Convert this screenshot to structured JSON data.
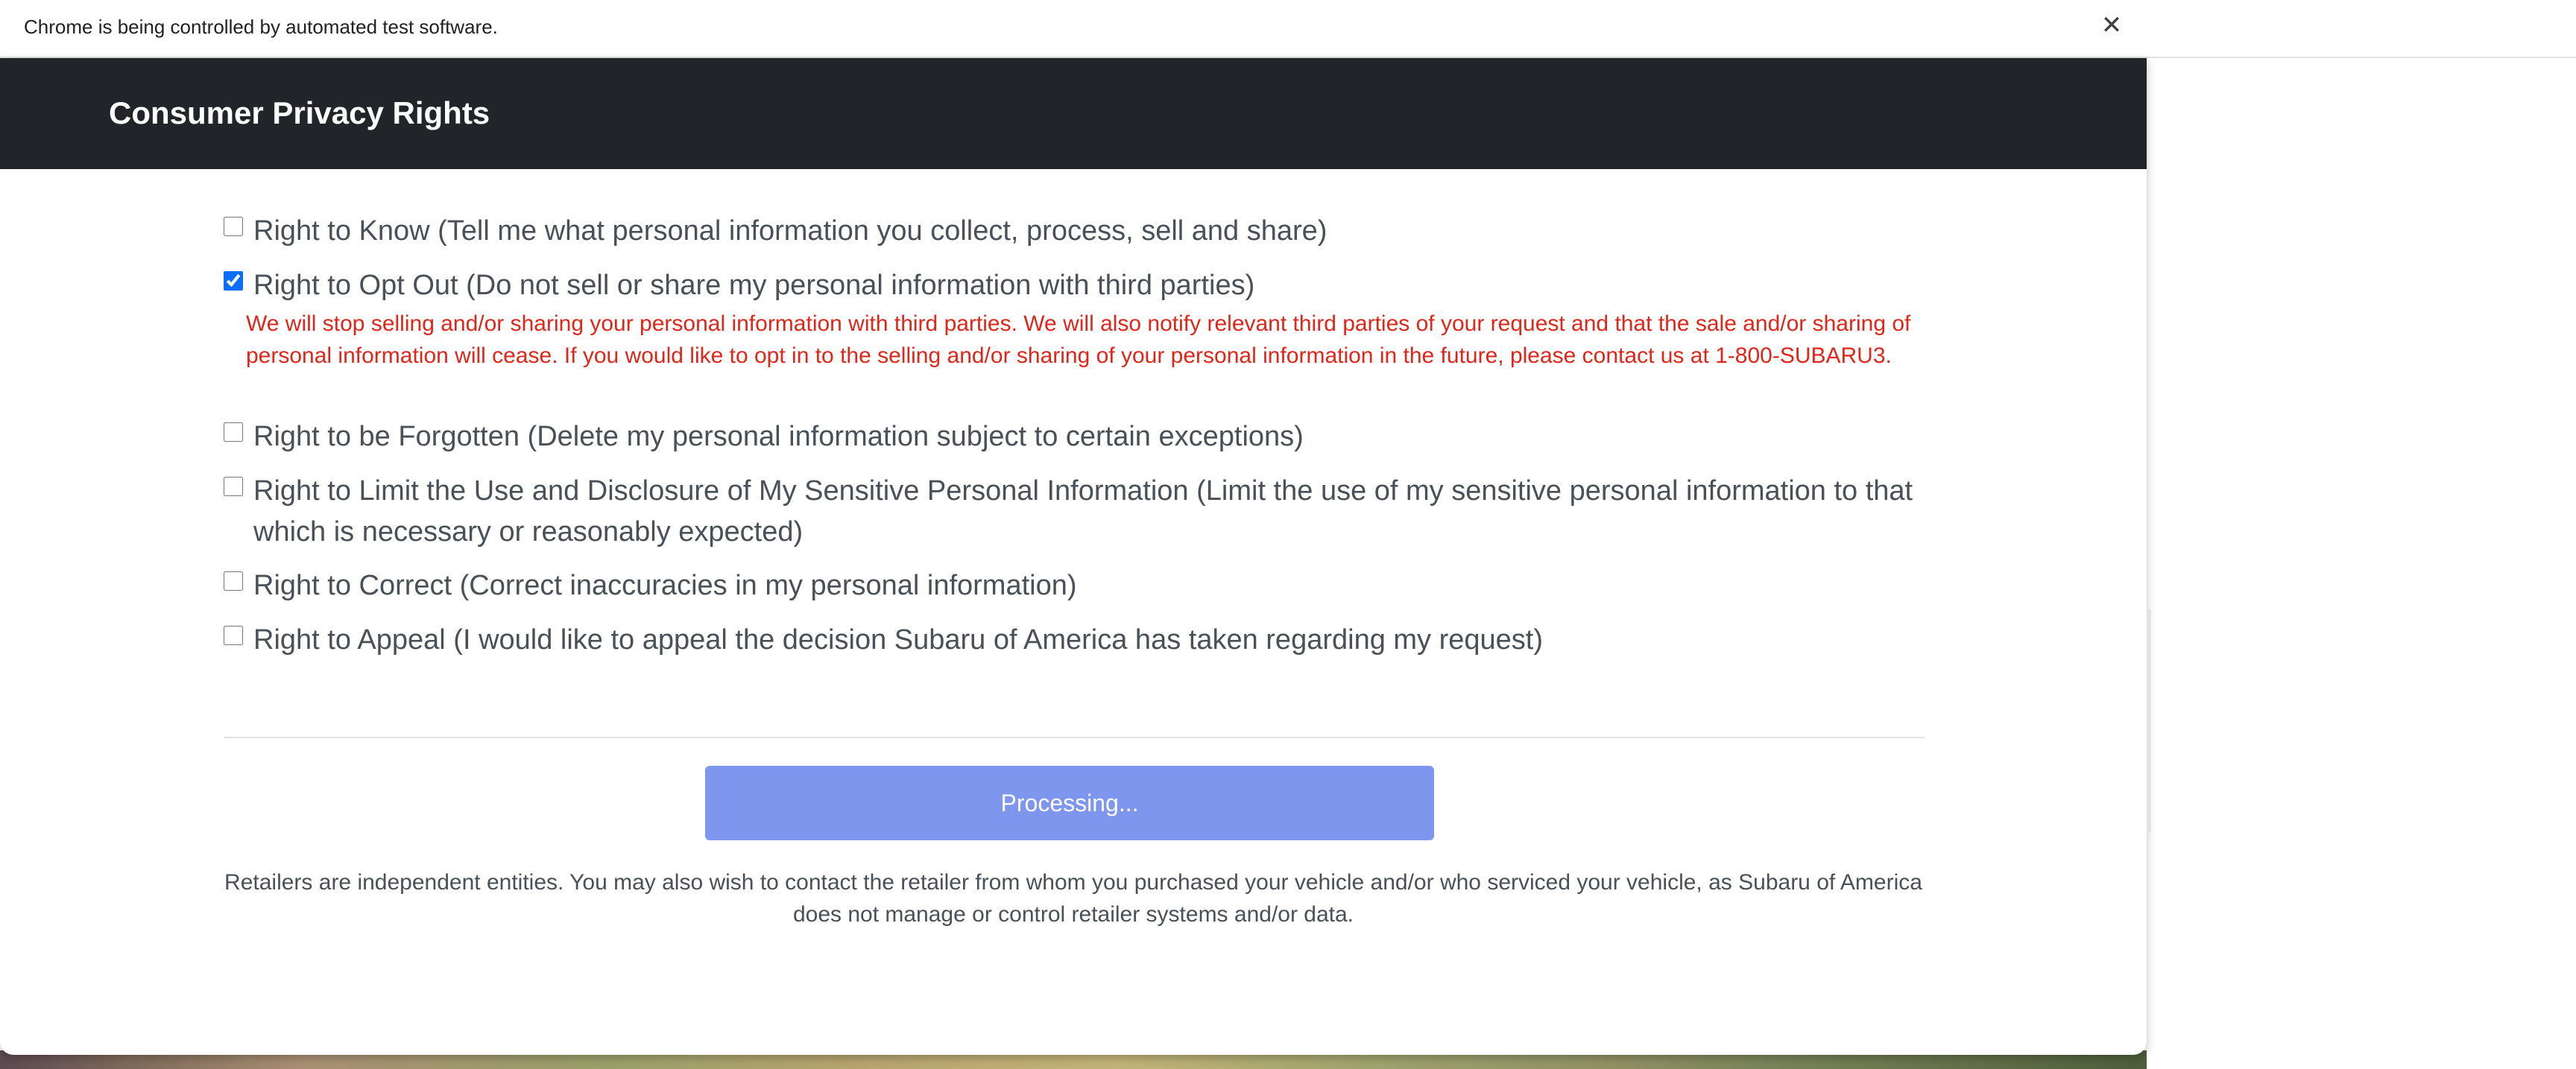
{
  "infobar": {
    "message": "Chrome is being controlled by automated test software.",
    "close_icon": "close-icon"
  },
  "header": {
    "title": "Consumer Privacy Rights"
  },
  "options": [
    {
      "checked": false,
      "label": "Right to Know (Tell me what personal information you collect, process, sell and share)"
    },
    {
      "checked": true,
      "label": "Right to Opt Out (Do not sell or share my personal information with third parties)",
      "note": "We will stop selling and/or sharing your personal information with third parties. We will also notify relevant third parties of your request and that the sale and/or sharing of personal information will cease. If you would like to opt in to the selling and/or sharing of your personal information in the future, please contact us at 1-800-SUBARU3."
    },
    {
      "checked": false,
      "label": "Right to be Forgotten (Delete my personal information subject to certain exceptions)"
    },
    {
      "checked": false,
      "label": "Right to Limit the Use and Disclosure of My Sensitive Personal Information (Limit the use of my sensitive personal information to that which is necessary or reasonably expected)"
    },
    {
      "checked": false,
      "label": "Right to Correct (Correct inaccuracies in my personal information)"
    },
    {
      "checked": false,
      "label": "Right to Appeal (I would like to appeal the decision Subaru of America has taken regarding my request)"
    }
  ],
  "submit": {
    "label": "Processing..."
  },
  "footer": {
    "text": "Retailers are independent entities. You may also wish to contact the retailer from whom you purchased your vehicle and/or who serviced your vehicle, as Subaru of America does not manage or control retailer systems and/or data."
  },
  "colors": {
    "header_bg": "#212529",
    "note_red": "#e0261a",
    "button_bg": "#7f96ef",
    "text_gray": "#495057"
  }
}
